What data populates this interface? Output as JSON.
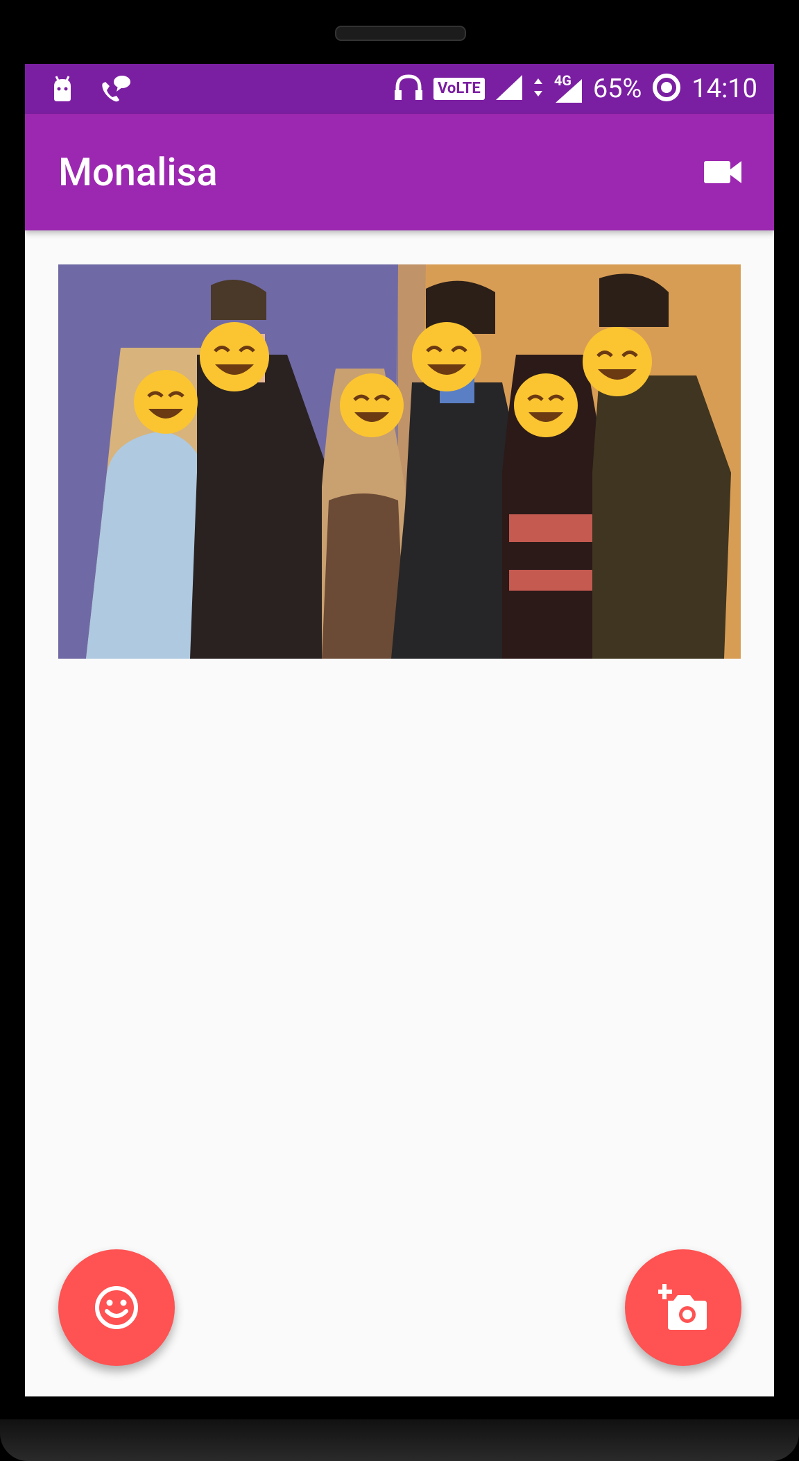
{
  "statusbar": {
    "battery": "65%",
    "time": "14:10",
    "network": "4G",
    "volte": "VoLTE",
    "icons": [
      "android-notification-icon",
      "wifi-calling-icon",
      "headset-icon",
      "signal-icon",
      "data-arrows-icon",
      "battery-saver-icon"
    ]
  },
  "appbar": {
    "title": "Monalisa",
    "action_icon": "video-camera-icon"
  },
  "content": {
    "image": "group-photo-with-emoji-faces"
  },
  "fabs": {
    "left_icon": "smiley-face-icon",
    "right_icon": "add-photo-icon"
  },
  "colors": {
    "statusbar": "#7b1fa2",
    "appbar": "#9c27b0",
    "fab": "#ff5252",
    "background": "#fafafa"
  }
}
